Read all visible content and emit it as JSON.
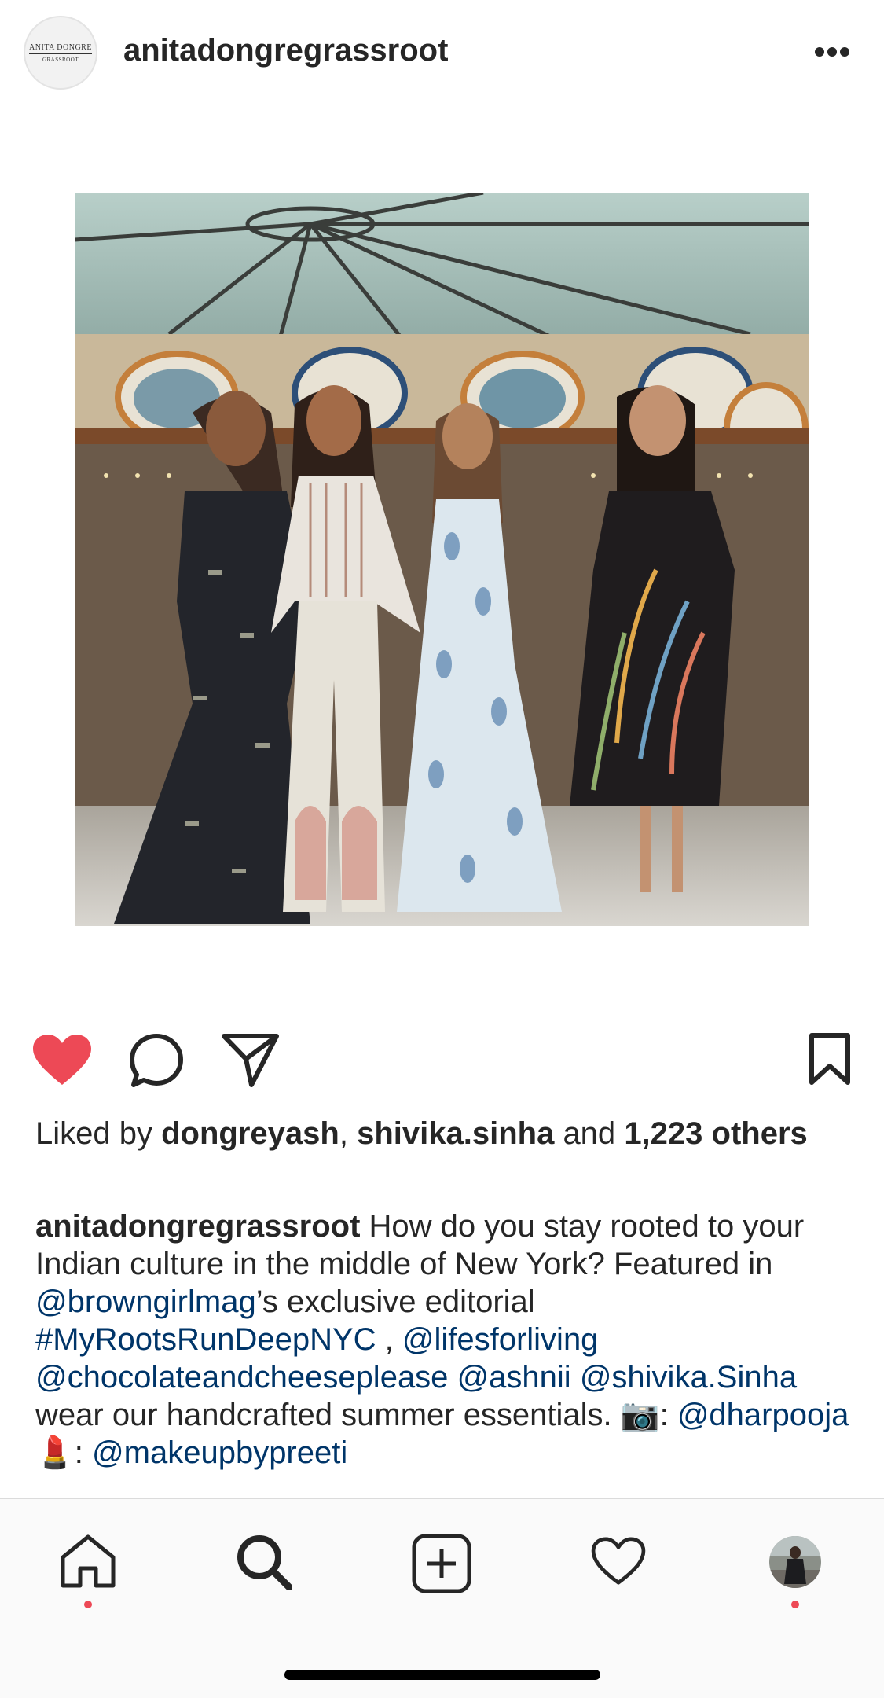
{
  "post": {
    "username": "anitadongregrassroot",
    "avatar_brand_line1": "ANITA DONGRE",
    "avatar_brand_line2": "GRASSROOT",
    "more_icon": "more-horizontal-icon",
    "liked": true,
    "likes": {
      "prefix": "Liked by",
      "user1": "dongreyash",
      "separator": ",",
      "user2": "shivika.sinha",
      "and": "and",
      "count_text": "1,223 others"
    },
    "caption": {
      "username": "anitadongregrassroot",
      "text1": " How do you stay rooted to your Indian culture in the middle of New York? Featured in ",
      "mention1": "@browngirlmag",
      "text2": "’s exclusive editorial ",
      "hashtag1": "#MyRootsRunDeepNYC",
      "text3": " , ",
      "mention2": "@lifesforliving",
      "text4": " ",
      "mention3": "@chocolateandcheeseplease",
      "text5": " ",
      "mention4": "@ashnii",
      "text6": " ",
      "mention5": "@shivika.Sinha",
      "text7": " wear our handcrafted summer essentials. 📷: ",
      "mention6": "@dharpooja",
      "text8": " 💄: ",
      "mention7": "@makeupbypreeti"
    }
  },
  "actions": {
    "like": "heart-filled-icon",
    "comment": "comment-icon",
    "share": "direct-share-icon",
    "save": "bookmark-icon"
  },
  "tabbar": {
    "items": [
      {
        "name": "home",
        "icon": "home-icon",
        "active": true,
        "has_dot": true
      },
      {
        "name": "search",
        "icon": "search-icon",
        "active": false,
        "has_dot": false
      },
      {
        "name": "new-post",
        "icon": "add-post-icon",
        "active": false,
        "has_dot": false
      },
      {
        "name": "activity",
        "icon": "heart-outline-icon",
        "active": false,
        "has_dot": false
      },
      {
        "name": "profile",
        "icon": "profile-avatar",
        "active": false,
        "has_dot": true
      }
    ]
  },
  "colors": {
    "text": "#262626",
    "link": "#003569",
    "like_red": "#ed4956",
    "divider": "#dbdbdb"
  }
}
